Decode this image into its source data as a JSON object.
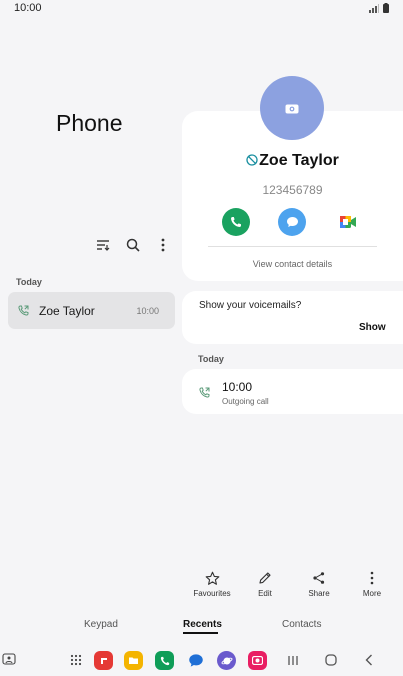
{
  "status_bar": {
    "time": "10:00"
  },
  "app": {
    "title": "Phone"
  },
  "recents_list": {
    "section_label": "Today",
    "items": [
      {
        "name": "Zoe Taylor",
        "time": "10:00"
      }
    ]
  },
  "contact": {
    "name": "Zoe Taylor",
    "number": "123456789",
    "view_details_label": "View contact details"
  },
  "voicemail": {
    "question": "Show your voicemails?",
    "show_label": "Show"
  },
  "call_log": {
    "section_label": "Today",
    "entries": [
      {
        "time": "10:00",
        "type": "Outgoing call"
      }
    ]
  },
  "bottom_actions": {
    "favourites": "Favourites",
    "edit": "Edit",
    "share": "Share",
    "more": "More"
  },
  "nav_tabs": {
    "keypad": "Keypad",
    "recents": "Recents",
    "contacts": "Contacts"
  },
  "colors": {
    "avatar": "#8ca1e0",
    "call_green": "#1aa260",
    "message_blue": "#4da3ee",
    "accent": "#111111"
  }
}
